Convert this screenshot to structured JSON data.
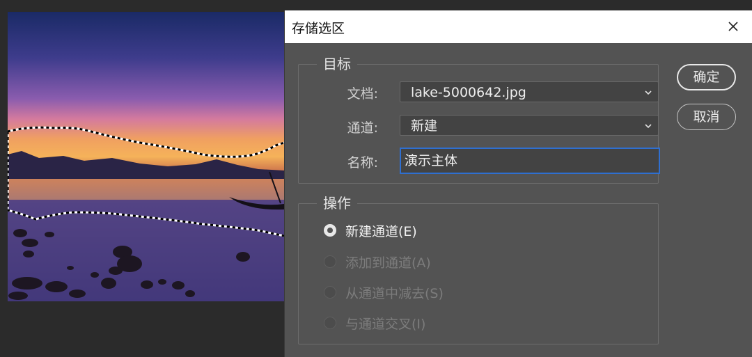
{
  "dialog": {
    "title": "存储选区",
    "close_icon": "close-icon"
  },
  "target_group": {
    "legend": "目标",
    "document_label": "文档:",
    "document_value": "lake-5000642.jpg",
    "channel_label": "通道:",
    "channel_value": "新建",
    "name_label": "名称:",
    "name_value": "演示主体"
  },
  "operation_group": {
    "legend": "操作",
    "options": [
      {
        "label": "新建通道(E)",
        "selected": true,
        "enabled": true
      },
      {
        "label": "添加到通道(A)",
        "selected": false,
        "enabled": false
      },
      {
        "label": "从通道中减去(S)",
        "selected": false,
        "enabled": false
      },
      {
        "label": "与通道交叉(I)",
        "selected": false,
        "enabled": false
      }
    ]
  },
  "buttons": {
    "ok": "确定",
    "cancel": "取消"
  },
  "colors": {
    "dialog_bg": "#535353",
    "focus_border": "#2f6fd0",
    "workspace_bg": "#2b2b2b"
  }
}
